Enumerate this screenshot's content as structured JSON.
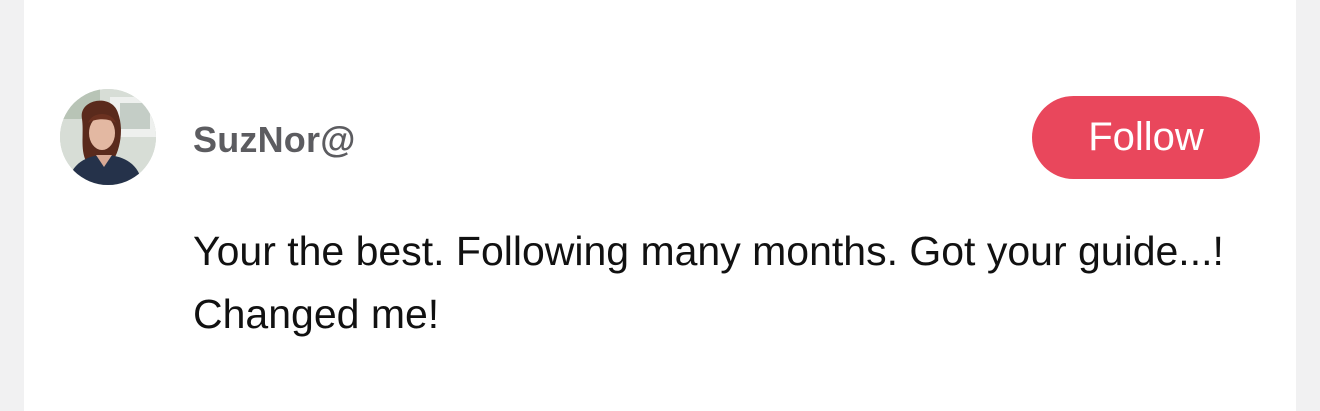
{
  "comment": {
    "author": {
      "username": "SuzNor@",
      "avatar": "user-avatar-photo"
    },
    "follow_label": "Follow",
    "text": "Your the best. Following many months. Got your guide...! Changed me!"
  },
  "colors": {
    "follow_button_bg": "#e9475c",
    "username_text": "#5c5c60",
    "comment_text": "#111111",
    "card_bg": "#ffffff",
    "page_bg": "#f1f1f2"
  }
}
